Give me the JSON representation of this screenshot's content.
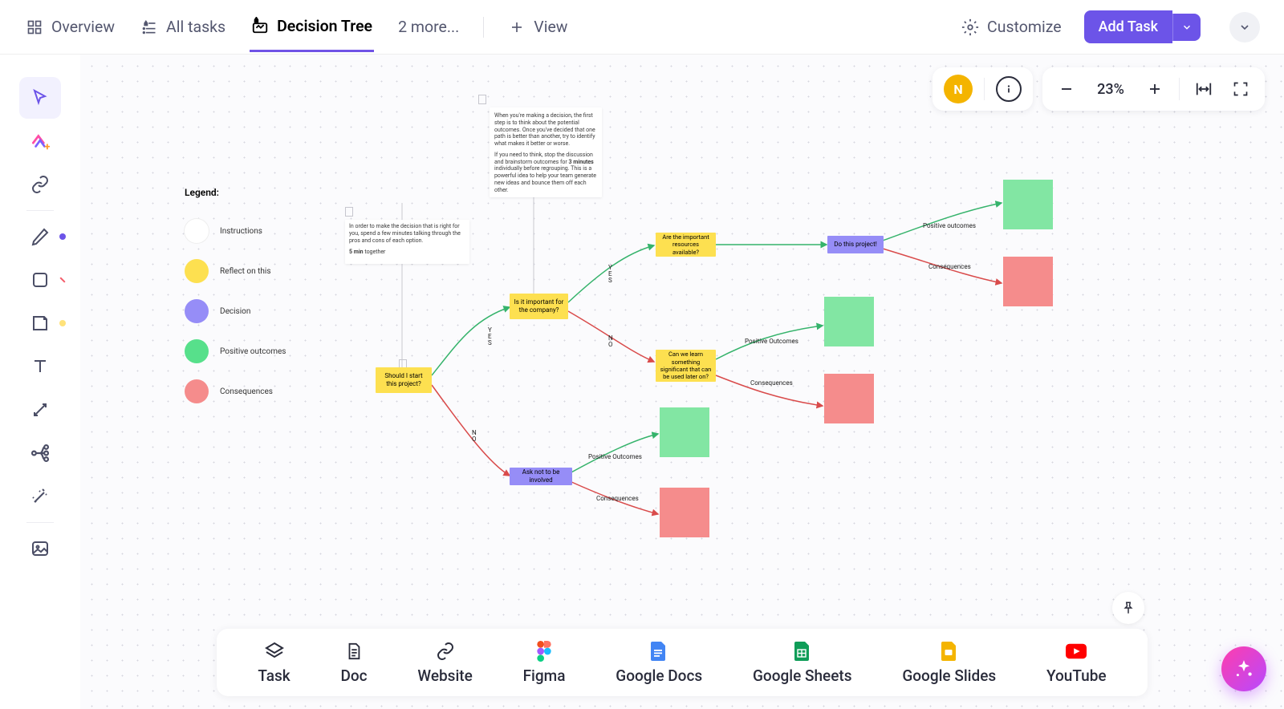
{
  "nav": {
    "overview": "Overview",
    "all_tasks": "All tasks",
    "decision_tree": "Decision Tree",
    "more": "2 more...",
    "view": "View",
    "customize": "Customize",
    "add_task": "Add Task"
  },
  "avatar_initial": "N",
  "zoom": "23%",
  "legend": {
    "title": "Legend:",
    "items": [
      {
        "label": "Instructions",
        "color": "#ffffff"
      },
      {
        "label": "Reflect on this",
        "color": "#fde050"
      },
      {
        "label": "Decision",
        "color": "#968df7"
      },
      {
        "label": "Positive outcomes",
        "color": "#57e08b"
      },
      {
        "label": "Consequences",
        "color": "#f58c8c"
      }
    ]
  },
  "instruction_boxes": {
    "left": {
      "line1": "In order to make the decision that is right for you, spend a few minutes talking through the pros and cons of each option.",
      "line2_bold": "5 min",
      "line2_rest": " together"
    },
    "top": {
      "p1": "When you're making a decision, the first step is to think about the potential outcomes. Once you've decided that one path is better than another, try to identify what makes it better or worse.",
      "p2a": "If you need to think, stop the discussion and brainstorm outcomes for ",
      "p2bold": "3 minutes",
      "p2b": " individually before regrouping. This is a powerful idea to help your team generate new ideas and bounce them off each other."
    }
  },
  "nodes": {
    "start": "Should I start this project?",
    "important": "Is it important for the company?",
    "ask_not": "Ask not to be involved",
    "resources": "Are the important resources available?",
    "learn": "Can we learn something significant that can be used later on?",
    "do_project": "Do this project!"
  },
  "edge_labels": {
    "yes_v": "Y\nE\nS",
    "no_v": "N\nO",
    "pos_outcomes": "Positive Outcomes",
    "pos_outcomes2": "Positive outcomes",
    "consequences": "Consequences"
  },
  "cards": {
    "task": "Task",
    "doc": "Doc",
    "website": "Website",
    "figma": "Figma",
    "gdocs": "Google Docs",
    "gsheets": "Google Sheets",
    "gslides": "Google Slides",
    "youtube": "YouTube"
  }
}
